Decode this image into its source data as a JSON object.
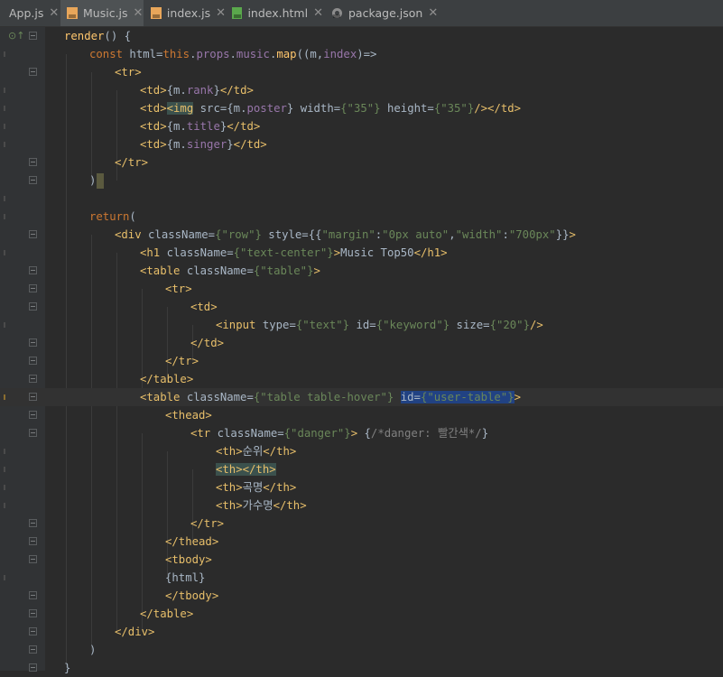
{
  "tabs": [
    {
      "name": "App.js",
      "icon": "js-file-icon"
    },
    {
      "name": "Music.js",
      "icon": "js-file-icon",
      "active": true
    },
    {
      "name": "index.js",
      "icon": "js-file-icon"
    },
    {
      "name": "index.html",
      "icon": "html-file-icon"
    },
    {
      "name": "package.json",
      "icon": "json-file-icon"
    }
  ],
  "close_glyph": "✕",
  "code": {
    "l1": {
      "fn": "render",
      "rest": "() {"
    },
    "l2": {
      "kw": "const ",
      "var": "html",
      "eq": "=",
      "this": "this",
      "dot1": ".",
      "props": "props",
      "dot2": ".",
      "music": "music",
      "dot3": ".",
      "map": "map",
      "rest": "((m,",
      "index": "index",
      "arrow": ")=>"
    },
    "l3": {
      "tag": "<tr>"
    },
    "l4": {
      "open": "<td>",
      "expr1": "{m.",
      "prop": "rank",
      "expr2": "}",
      "close": "</td>"
    },
    "l5": {
      "open": "<td>",
      "img": "<img",
      "a1": " src=",
      "v1a": "{m.",
      "v1p": "poster",
      "v1b": "}",
      "a2": " width=",
      "v2": "{\"35\"}",
      "a3": " height=",
      "v3": "{\"35\"}",
      "end": "/></td>"
    },
    "l6": {
      "open": "<td>",
      "expr1": "{m.",
      "prop": "title",
      "expr2": "}",
      "close": "</td>"
    },
    "l7": {
      "open": "<td>",
      "expr1": "{m.",
      "prop": "singer",
      "expr2": "}",
      "close": "</td>"
    },
    "l8": {
      "tag": "</tr>"
    },
    "l9": {
      "text": ")"
    },
    "l11": {
      "kw": "return",
      "rest": "("
    },
    "l12": {
      "tag": "<div",
      "a1": " className=",
      "v1": "{\"row\"}",
      "a2": " style=",
      "v2a": "{{",
      "v2b": "\"margin\"",
      "v2c": ":",
      "v2d": "\"0px auto\"",
      "v2e": ",",
      "v2f": "\"width\"",
      "v2g": ":",
      "v2h": "\"700px\"",
      "v2i": "}}",
      "end": ">"
    },
    "l13": {
      "tag": "<h1",
      "a1": " className=",
      "v1": "{\"text-center\"}",
      "gt": ">",
      "text": "Music Top50",
      "close": "</h1>"
    },
    "l14": {
      "tag": "<table",
      "a1": " className=",
      "v1": "{\"table\"}",
      "end": ">"
    },
    "l15": {
      "tag": "<tr>"
    },
    "l16": {
      "tag": "<td>"
    },
    "l17": {
      "tag": "<input",
      "a1": " type=",
      "v1": "{\"text\"}",
      "a2": " id=",
      "v2": "{\"keyword\"}",
      "a3": " size=",
      "v3": "{\"20\"}",
      "end": "/>"
    },
    "l18": {
      "tag": "</td>"
    },
    "l19": {
      "tag": "</tr>"
    },
    "l20": {
      "tag": "</table>"
    },
    "l21": {
      "tag": "<table",
      "a1": " className=",
      "v1": "{\"table table-hover\"}",
      "sp": " ",
      "a2": "id=",
      "v2": "{\"user-table\"}",
      "end": ">"
    },
    "l22": {
      "tag": "<thead>"
    },
    "l23": {
      "tag": "<tr",
      "a1": " className=",
      "v1": "{\"danger\"}",
      "gt": ">",
      "sp": " ",
      "cm1": "{",
      "cm2": "/*danger: 빨간색*/",
      "cm3": "}"
    },
    "l24": {
      "open": "<th>",
      "text": "순위",
      "close": "</th>"
    },
    "l25": {
      "open": "<th>",
      "close": "</th>"
    },
    "l26": {
      "open": "<th>",
      "text": "곡명",
      "close": "</th>"
    },
    "l27": {
      "open": "<th>",
      "text": "가수명",
      "close": "</th>"
    },
    "l28": {
      "tag": "</tr>"
    },
    "l29": {
      "tag": "</thead>"
    },
    "l30": {
      "tag": "<tbody>"
    },
    "l31": {
      "text": "{html}"
    },
    "l32": {
      "tag": "</tbody>"
    },
    "l33": {
      "tag": "</table>"
    },
    "l34": {
      "tag": "</div>"
    },
    "l35": {
      "text": ")"
    },
    "l36": {
      "text": "}"
    }
  }
}
